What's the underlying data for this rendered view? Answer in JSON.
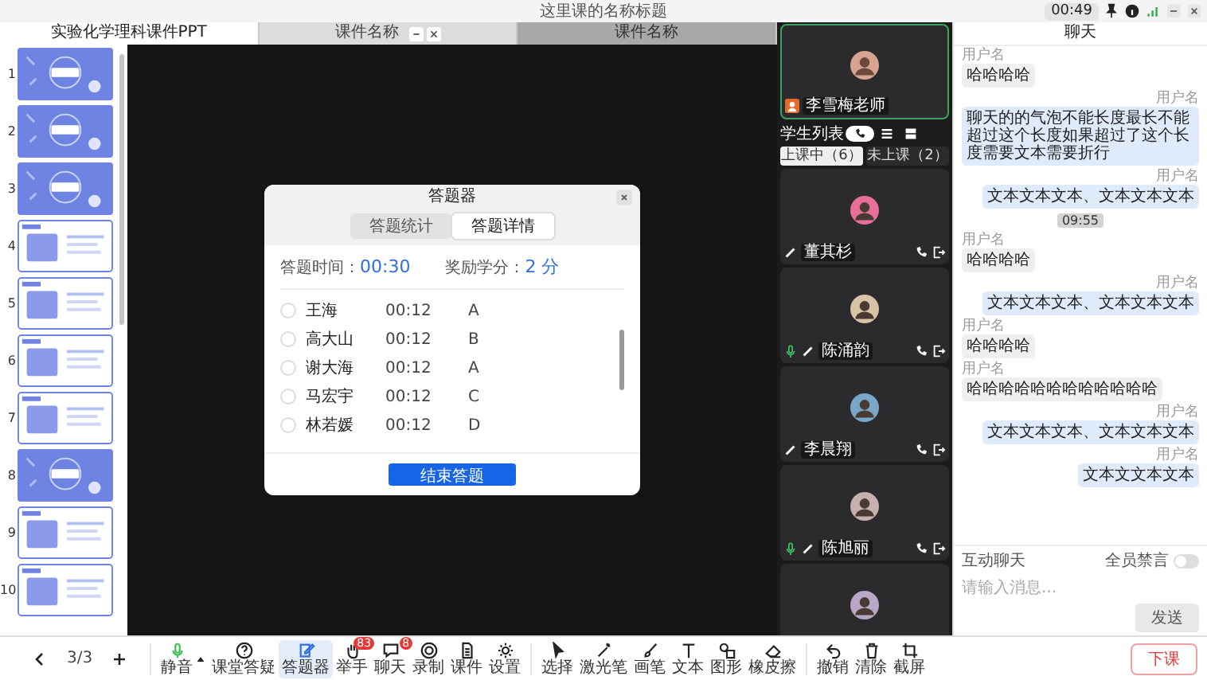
{
  "top_bar": {
    "title": "这里课的名称标题",
    "time": "00:49"
  },
  "tabs": [
    {
      "label": "实验化学理科课件PPT",
      "selected": true,
      "controls": false,
      "dimmed": false
    },
    {
      "label": "课件名称",
      "selected": false,
      "controls": true,
      "dimmed": false
    },
    {
      "label": "课件名称",
      "selected": false,
      "controls": false,
      "dimmed": true
    }
  ],
  "slides": [
    {
      "number": "1",
      "kind": "title"
    },
    {
      "number": "2",
      "kind": "title"
    },
    {
      "number": "3",
      "kind": "title"
    },
    {
      "number": "4",
      "kind": "content"
    },
    {
      "number": "5",
      "kind": "content"
    },
    {
      "number": "6",
      "kind": "content"
    },
    {
      "number": "7",
      "kind": "content"
    },
    {
      "number": "8",
      "kind": "title"
    },
    {
      "number": "9",
      "kind": "content"
    },
    {
      "number": "10",
      "kind": "content"
    }
  ],
  "quiz": {
    "title": "答题器",
    "tabs": [
      {
        "label": "答题统计",
        "selected": false
      },
      {
        "label": "答题详情",
        "selected": true
      }
    ],
    "time_label": "答题时间：",
    "time": "00:30",
    "reward_label": "奖励学分：",
    "reward": "2 分",
    "rows": [
      {
        "name": "王海",
        "time": "00:12",
        "answer": "A",
        "checked": false
      },
      {
        "name": "高大山",
        "time": "00:12",
        "answer": "B",
        "checked": false
      },
      {
        "name": "谢大海",
        "time": "00:12",
        "answer": "A",
        "checked": false
      },
      {
        "name": "马宏宇",
        "time": "00:12",
        "answer": "C",
        "checked": false
      },
      {
        "name": "林若媛",
        "time": "00:12",
        "answer": "D",
        "checked": false
      }
    ],
    "button": "结束答题"
  },
  "videos": {
    "teacher": {
      "name": "李雪梅老师"
    },
    "list_label": "学生列表",
    "view_modes": [
      {
        "selected": true
      },
      {
        "selected": false
      },
      {
        "selected": false
      }
    ],
    "tabs": [
      {
        "label": "上课中（6）",
        "selected": true
      },
      {
        "label": "未上课（2）",
        "selected": false
      }
    ],
    "students": [
      {
        "kind": "full",
        "name": "董其杉",
        "mic": false,
        "pen": true
      },
      {
        "kind": "full",
        "name": "陈涌韵",
        "mic": true,
        "pen": true
      },
      {
        "kind": "full",
        "name": "李晨翔",
        "mic": false,
        "pen": true
      },
      {
        "kind": "full",
        "name": "陈旭丽",
        "mic": true,
        "pen": true
      },
      {
        "kind": "partial"
      }
    ]
  },
  "chat": {
    "title": "聊天",
    "messages": [
      {
        "kind": "received",
        "user": "用户名",
        "text": "哈哈哈哈"
      },
      {
        "kind": "sent",
        "user": "用户名",
        "text": "聊天的的气泡不能长度最长不能超过这个长度如果超过了这个长度需要文本需要折行"
      },
      {
        "kind": "sent",
        "user": "用户名",
        "text": "文本文本文本、文本文本文本"
      },
      {
        "kind": "time",
        "text": "09:55"
      },
      {
        "kind": "received",
        "user": "用户名",
        "text": "哈哈哈哈"
      },
      {
        "kind": "sent",
        "user": "用户名",
        "text": "文本文本文本、文本文本文本"
      },
      {
        "kind": "received",
        "user": "用户名",
        "text": "哈哈哈哈"
      },
      {
        "kind": "received",
        "user": "用户名",
        "text": "哈哈哈哈哈哈哈哈哈哈哈哈"
      },
      {
        "kind": "sent",
        "user": "用户名",
        "text": "文本文本文本、文本文本文本"
      },
      {
        "kind": "sent",
        "user": "用户名",
        "text": "文本文文本文本"
      }
    ],
    "section_label": "互动聊天",
    "mute_all": {
      "label": "全员禁言",
      "on": false
    },
    "placeholder": "请输入消息...",
    "send": "发送"
  },
  "toolbar": {
    "page": "3/3",
    "groups": [
      [
        {
          "label": "静音",
          "selected": false,
          "menu": true
        },
        {
          "label": "课堂答疑",
          "selected": false
        },
        {
          "label": "答题器",
          "selected": true
        },
        {
          "label": "举手",
          "selected": false,
          "badge": "83"
        },
        {
          "label": "聊天",
          "selected": false,
          "badge": "8"
        },
        {
          "label": "录制",
          "selected": false
        },
        {
          "label": "课件",
          "selected": false
        },
        {
          "label": "设置",
          "selected": false
        }
      ],
      [
        {
          "label": "选择",
          "selected": false
        },
        {
          "label": "激光笔",
          "selected": false
        },
        {
          "label": "画笔",
          "selected": false
        },
        {
          "label": "文本",
          "selected": false
        },
        {
          "label": "图形",
          "selected": false
        },
        {
          "label": "橡皮擦",
          "selected": false
        }
      ],
      [
        {
          "label": "撤销",
          "selected": false
        },
        {
          "label": "清除",
          "selected": false
        },
        {
          "label": "截屏",
          "selected": false
        }
      ]
    ],
    "end_button": "下课"
  }
}
